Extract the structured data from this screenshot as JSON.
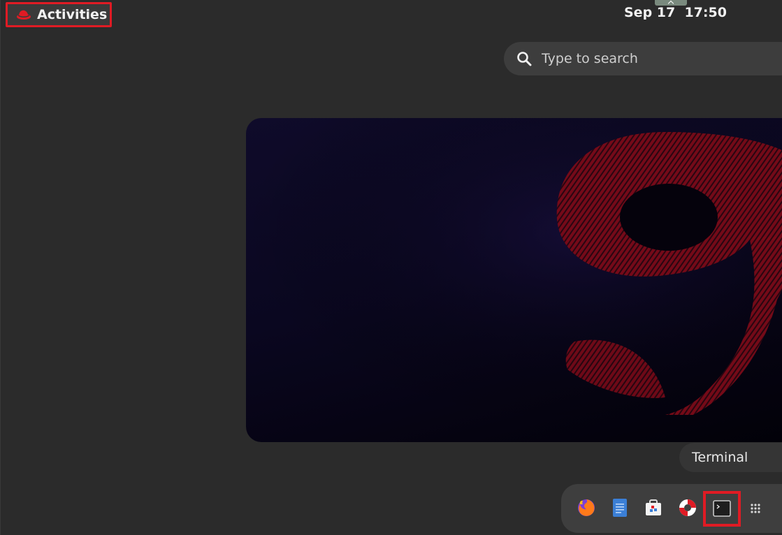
{
  "topbar": {
    "activities_label": "Activities",
    "clock": "Sep 17  17:50"
  },
  "search": {
    "placeholder": "Type to search"
  },
  "workspace": {
    "wallpaper_numeral": "9"
  },
  "tooltip": {
    "text": "Terminal"
  },
  "dash": {
    "items": [
      {
        "icon": "firefox-icon",
        "app": "Firefox"
      },
      {
        "icon": "text-editor-icon",
        "app": "Text Editor"
      },
      {
        "icon": "software-icon",
        "app": "Software"
      },
      {
        "icon": "help-icon",
        "app": "Help"
      },
      {
        "icon": "terminal-icon",
        "app": "Terminal"
      },
      {
        "icon": "app-grid-icon",
        "app": "Show Applications"
      }
    ]
  },
  "colors": {
    "highlight": "#e01b24",
    "background": "#2b2b2b",
    "brand_red": "#c4122d"
  }
}
